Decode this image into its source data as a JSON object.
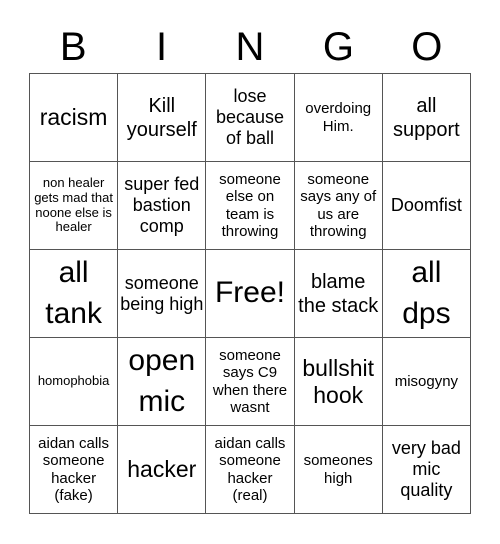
{
  "header": {
    "letters": [
      "B",
      "I",
      "N",
      "G",
      "O"
    ]
  },
  "cells": [
    [
      "racism",
      "Kill yourself",
      "lose because of ball",
      "overdoing Him.",
      "all support"
    ],
    [
      "non healer gets mad that noone else is healer",
      "super fed bastion comp",
      "someone else on team is throwing",
      "someone says any of us are throwing",
      "Doomfist"
    ],
    [
      "all tank",
      "someone being high",
      "Free!",
      "blame the stack",
      "all dps"
    ],
    [
      "homophobia",
      "open mic",
      "someone says C9 when there wasnt",
      "bullshit hook",
      "misogyny"
    ],
    [
      "aidan calls someone hacker (fake)",
      "hacker",
      "aidan calls someone hacker (real)",
      "someones high",
      "very bad mic quality"
    ]
  ]
}
